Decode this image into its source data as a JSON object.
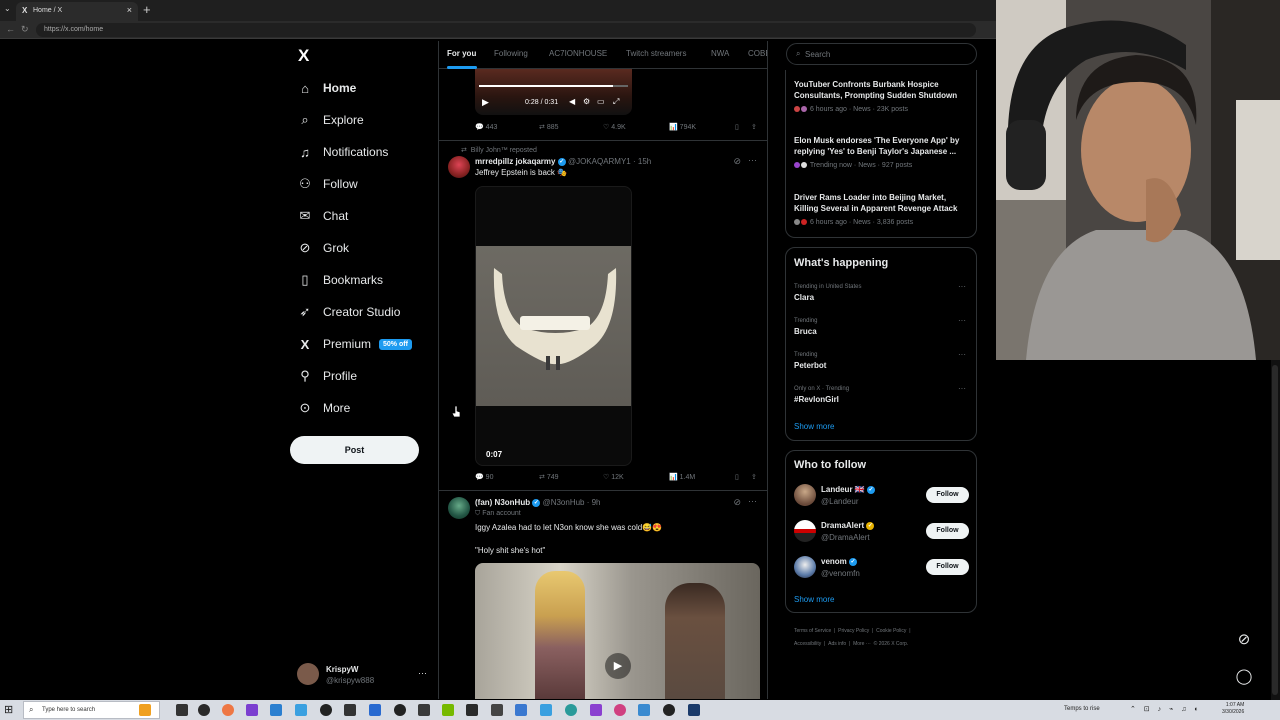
{
  "browser": {
    "tab_title": "Home / X",
    "tab_icon": "X",
    "close_glyph": "×",
    "new_tab_glyph": "+",
    "url": "https://x.com/home"
  },
  "nav": {
    "logo": "X",
    "items": [
      {
        "label": "Home",
        "icon": "home-icon"
      },
      {
        "label": "Explore",
        "icon": "search-icon"
      },
      {
        "label": "Notifications",
        "icon": "bell-icon"
      },
      {
        "label": "Follow",
        "icon": "person-plus-icon"
      },
      {
        "label": "Chat",
        "icon": "envelope-icon"
      },
      {
        "label": "Grok",
        "icon": "grok-icon"
      },
      {
        "label": "Bookmarks",
        "icon": "bookmark-icon"
      },
      {
        "label": "Creator Studio",
        "icon": "rocket-icon"
      },
      {
        "label": "Premium",
        "icon": "x-logo-icon",
        "badge": "50% off"
      },
      {
        "label": "Profile",
        "icon": "person-icon"
      },
      {
        "label": "More",
        "icon": "more-circle-icon"
      }
    ],
    "post_label": "Post",
    "account": {
      "name": "KrispyW",
      "handle": "@krispyw888",
      "dots": "···"
    }
  },
  "feed": {
    "tabs": [
      "For you",
      "Following",
      "AC7IONHOUSE",
      "Twitch streamers",
      "NWA",
      "COBE"
    ],
    "video1": {
      "time": "0:28 / 0:31"
    },
    "post0_actions": {
      "replies": "443",
      "reposts": "885",
      "likes": "4.9K",
      "views": "794K"
    },
    "post1": {
      "repost_label": "Billy John™ reposted",
      "name": "mrredpillz jokaqarmy",
      "meta": "@JOKAQARMY1 · 15h",
      "text": "Jeffrey Epstein is back 🎭",
      "video_time": "0:07",
      "actions": {
        "replies": "90",
        "reposts": "749",
        "likes": "12K",
        "views": "1.4M"
      }
    },
    "post2": {
      "name": "(fan) N3onHub",
      "meta": "@N3onHub · 9h",
      "label": "Fan account",
      "text": "Iggy Azalea had to let N3on know she was cold😅😍",
      "quote": "\"Holy shit she's hot\""
    }
  },
  "sidebar": {
    "search_placeholder": "Search",
    "news": [
      {
        "title": "YouTuber Confronts Burbank Hospice Consultants, Prompting Sudden Shutdown",
        "meta": "6 hours ago · News · 23K posts"
      },
      {
        "title": "Elon Musk endorses 'The Everyone App' by replying 'Yes' to Benji Taylor's Japanese ...",
        "meta": "Trending now · News · 927 posts"
      },
      {
        "title": "Driver Rams Loader into Beijing Market, Killing Several in Apparent Revenge Attack",
        "meta": "6 hours ago · News · 3,836 posts"
      }
    ],
    "happening": {
      "title": "What's happening",
      "trends": [
        {
          "context": "Trending in United States",
          "name": "Clara"
        },
        {
          "context": "Trending",
          "name": "Bruca"
        },
        {
          "context": "Trending",
          "name": "Peterbot"
        },
        {
          "context": "Only on X · Trending",
          "name": "#RevlonGirl"
        }
      ],
      "show_more": "Show more",
      "more_glyph": "···"
    },
    "who_to_follow": {
      "title": "Who to follow",
      "users": [
        {
          "name": "Landeur 🇬🇧",
          "handle": "@Landeur",
          "button": "Follow"
        },
        {
          "name": "DramaAlert",
          "handle": "@DramaAlert",
          "button": "Follow"
        },
        {
          "name": "venom",
          "handle": "@venomfn",
          "button": "Follow"
        }
      ],
      "show_more": "Show more"
    },
    "footer": [
      "Terms of Service",
      "|",
      "Privacy Policy",
      "|",
      "Cookie Policy",
      "|",
      "Accessibility",
      "|",
      "Ads info",
      "|",
      "More ···",
      "© 2026 X Corp."
    ]
  },
  "taskbar": {
    "search_placeholder": "Type here to search",
    "weather": "Temps to rise",
    "clock_time": "1:07 AM",
    "clock_date": "3/30/2026"
  }
}
